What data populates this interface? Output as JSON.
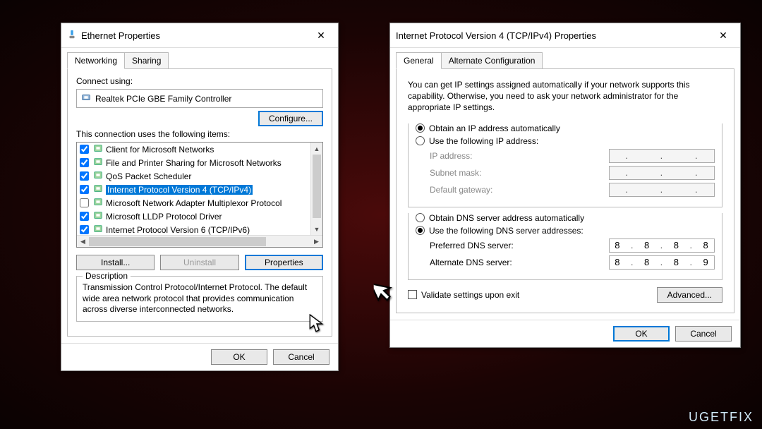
{
  "watermark": "UGETFIX",
  "dialog1": {
    "title": "Ethernet Properties",
    "tabs": [
      "Networking",
      "Sharing"
    ],
    "connect_using_label": "Connect using:",
    "adapter": "Realtek PCIe GBE Family Controller",
    "configure_btn": "Configure...",
    "items_label": "This connection uses the following items:",
    "items": [
      {
        "checked": true,
        "label": "Client for Microsoft Networks",
        "selected": false
      },
      {
        "checked": true,
        "label": "File and Printer Sharing for Microsoft Networks",
        "selected": false
      },
      {
        "checked": true,
        "label": "QoS Packet Scheduler",
        "selected": false
      },
      {
        "checked": true,
        "label": "Internet Protocol Version 4 (TCP/IPv4)",
        "selected": true
      },
      {
        "checked": false,
        "label": "Microsoft Network Adapter Multiplexor Protocol",
        "selected": false
      },
      {
        "checked": true,
        "label": "Microsoft LLDP Protocol Driver",
        "selected": false
      },
      {
        "checked": true,
        "label": "Internet Protocol Version 6 (TCP/IPv6)",
        "selected": false
      }
    ],
    "install_btn": "Install...",
    "uninstall_btn": "Uninstall",
    "properties_btn": "Properties",
    "description_label": "Description",
    "description_text": "Transmission Control Protocol/Internet Protocol. The default wide area network protocol that provides communication across diverse interconnected networks.",
    "ok_btn": "OK",
    "cancel_btn": "Cancel"
  },
  "dialog2": {
    "title": "Internet Protocol Version 4 (TCP/IPv4) Properties",
    "tabs": [
      "General",
      "Alternate Configuration"
    ],
    "intro": "You can get IP settings assigned automatically if your network supports this capability. Otherwise, you need to ask your network administrator for the appropriate IP settings.",
    "ip_auto": "Obtain an IP address automatically",
    "ip_manual": "Use the following IP address:",
    "ip_label": "IP address:",
    "subnet_label": "Subnet mask:",
    "gateway_label": "Default gateway:",
    "dns_auto": "Obtain DNS server address automatically",
    "dns_manual": "Use the following DNS server addresses:",
    "pref_dns_label": "Preferred DNS server:",
    "alt_dns_label": "Alternate DNS server:",
    "pref_dns": [
      "8",
      "8",
      "8",
      "8"
    ],
    "alt_dns": [
      "8",
      "8",
      "8",
      "9"
    ],
    "validate_label": "Validate settings upon exit",
    "advanced_btn": "Advanced...",
    "ok_btn": "OK",
    "cancel_btn": "Cancel"
  }
}
